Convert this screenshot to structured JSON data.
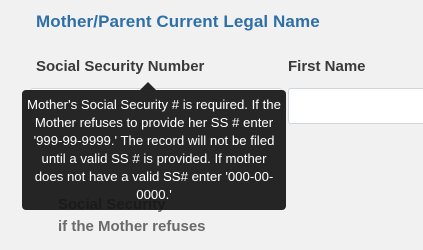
{
  "section": {
    "title": "Mother/Parent Current Legal Name"
  },
  "fields": {
    "ssn_label": "Social Security Number",
    "first_name_label": "First Name",
    "ssn_value": "",
    "first_name_value": ""
  },
  "tooltip": {
    "text": "Mother's Social Security # is required. If the Mother refuses to provide her SS # enter '999-99-9999.' The record will not be filed until a valid SS # is provided. If mother does not have a valid SS# enter '000-00-0000.'"
  },
  "obscured": {
    "line1": "Social Security",
    "line2": "if the Mother refuses"
  }
}
